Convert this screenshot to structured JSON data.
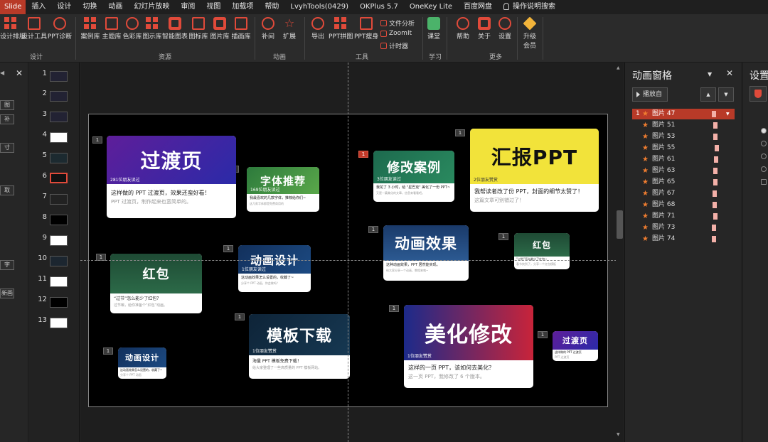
{
  "menu": {
    "items": [
      "Slide",
      "插入",
      "设计",
      "切换",
      "动画",
      "幻灯片放映",
      "审阅",
      "视图",
      "加载项",
      "帮助",
      "LvyhTools(0429)",
      "OKPlus 5.7",
      "OneKey Lite",
      "百度网盘"
    ],
    "search": "操作说明搜索"
  },
  "ribbon": {
    "buttons": {
      "design_layout": "设计排版",
      "design_tools": "设计工具",
      "ppt_diagnose": "PPT诊断",
      "case_lib": "案例库",
      "theme_lib": "主题库",
      "color_lib": "色彩库",
      "chart_lib": "图示库",
      "smart_chart": "智能图表",
      "icon_lib": "图标库",
      "image_lib": "图片库",
      "illustration_lib": "插画库",
      "supplement": "补间",
      "expand": "扩展",
      "export": "导出",
      "ppt_puzzle": "PPT拼图",
      "ppt_slim": "PPT瘦身",
      "file_analysis": "文件分析",
      "zoomit": "ZoomIt",
      "timer": "计时器",
      "classroom": "课堂",
      "help": "帮助",
      "about": "关于",
      "settings": "设置",
      "upgrade_line1": "升级",
      "upgrade_line2": "会员"
    },
    "groups": {
      "design": "设计",
      "resources": "资源",
      "animation": "动画",
      "tools": "工具",
      "learning": "学习",
      "more": "更多"
    }
  },
  "left_panel": {
    "buttons": [
      "图",
      "补",
      "寸",
      "取",
      "字",
      "新画"
    ]
  },
  "thumbnails": [
    "1",
    "2",
    "3",
    "4",
    "5",
    "6",
    "7",
    "8",
    "9",
    "10",
    "11",
    "12",
    "13"
  ],
  "slide": {
    "tags": [
      "1",
      "1",
      "1",
      "1",
      "1",
      "1",
      "1",
      "1",
      "1",
      "1",
      "1",
      "1"
    ],
    "cards": [
      {
        "title": "过渡页",
        "badge": "281位朋友读过",
        "line1": "这样做的 PPT 过渡页，效果还蛮好看！",
        "line2": "PPT 过渡页，制作起来也蛮简单的。"
      },
      {
        "title": "字体推荐",
        "badge": "169位朋友读过",
        "line1": "我最喜欢的几款字体，推荐给你们~",
        "line2": "这几款字体都是免费商用的"
      },
      {
        "title": "修改案例",
        "badge": "3位朋友读过",
        "line1": "我花了 3 小时，给 \"星巴克\" 美化了一份 PPT~",
        "line2": "又是一篇美化的文章，信息来看看吧。"
      },
      {
        "title": "汇报PPT",
        "badge": "2位朋友赞赏",
        "line1": "我帮读者改了份 PPT，封面的细节太赞了！",
        "line2": "这篇文章可别错过了！"
      },
      {
        "title": "动画效果",
        "badge": "",
        "line1": "这种动画效果，PPT 居然能实现。",
        "line2": "给大家分享一个动画，教程来咯~"
      },
      {
        "title": "红包",
        "badge": "",
        "line1": "“过节”怎么能少了红包~",
        "line2": "春节快到了，分享一个红包模板"
      },
      {
        "title": "红包",
        "badge": "",
        "line1": "“过节”怎么能少了红包？",
        "line2": "过节嘛，给你准备个“红包”动画。"
      },
      {
        "title": "动画设计",
        "badge": "1位朋友读过",
        "line1": "这动画效果怎么设置的，收藏了~",
        "line2": "分享个 PPT 动画，你会做吗？"
      },
      {
        "title": "模板下载",
        "badge": "1位朋友赞赏",
        "line1": "海量 PPT 模板免费下载！",
        "line2": "给大家整理了一些高质量的 PPT 模板网站。"
      },
      {
        "title": "美化修改",
        "badge": "1位朋友赞赏",
        "line1": "这样的一页 PPT，该如何去美化？",
        "line2": "这一页 PPT，我修改了 6 个版本。"
      },
      {
        "title": "动画设计",
        "badge": "",
        "line1": "这动画效果怎么设置的，收藏了~",
        "line2": "分享个 PPT 动画"
      },
      {
        "title": "过渡页",
        "badge": "",
        "line1": "这样做的 PPT 过渡页",
        "line2": "PPT 过渡页"
      }
    ]
  },
  "anim_pane": {
    "title": "动画窗格",
    "play_label": "播放自",
    "items": [
      {
        "num": "1",
        "name": "图片 47"
      },
      {
        "num": "",
        "name": "图片 51"
      },
      {
        "num": "",
        "name": "图片 53"
      },
      {
        "num": "",
        "name": "图片 55"
      },
      {
        "num": "",
        "name": "图片 61"
      },
      {
        "num": "",
        "name": "图片 63"
      },
      {
        "num": "",
        "name": "图片 65"
      },
      {
        "num": "",
        "name": "图片 67"
      },
      {
        "num": "",
        "name": "图片 68"
      },
      {
        "num": "",
        "name": "图片 71"
      },
      {
        "num": "",
        "name": "图片 73"
      },
      {
        "num": "",
        "name": "图片 74"
      }
    ]
  },
  "settings_pane": {
    "title": "设置"
  },
  "colors": {
    "accent": "#b83a28",
    "ribbon_icon": "#e04a3a",
    "anim_star": "#f07d30"
  }
}
